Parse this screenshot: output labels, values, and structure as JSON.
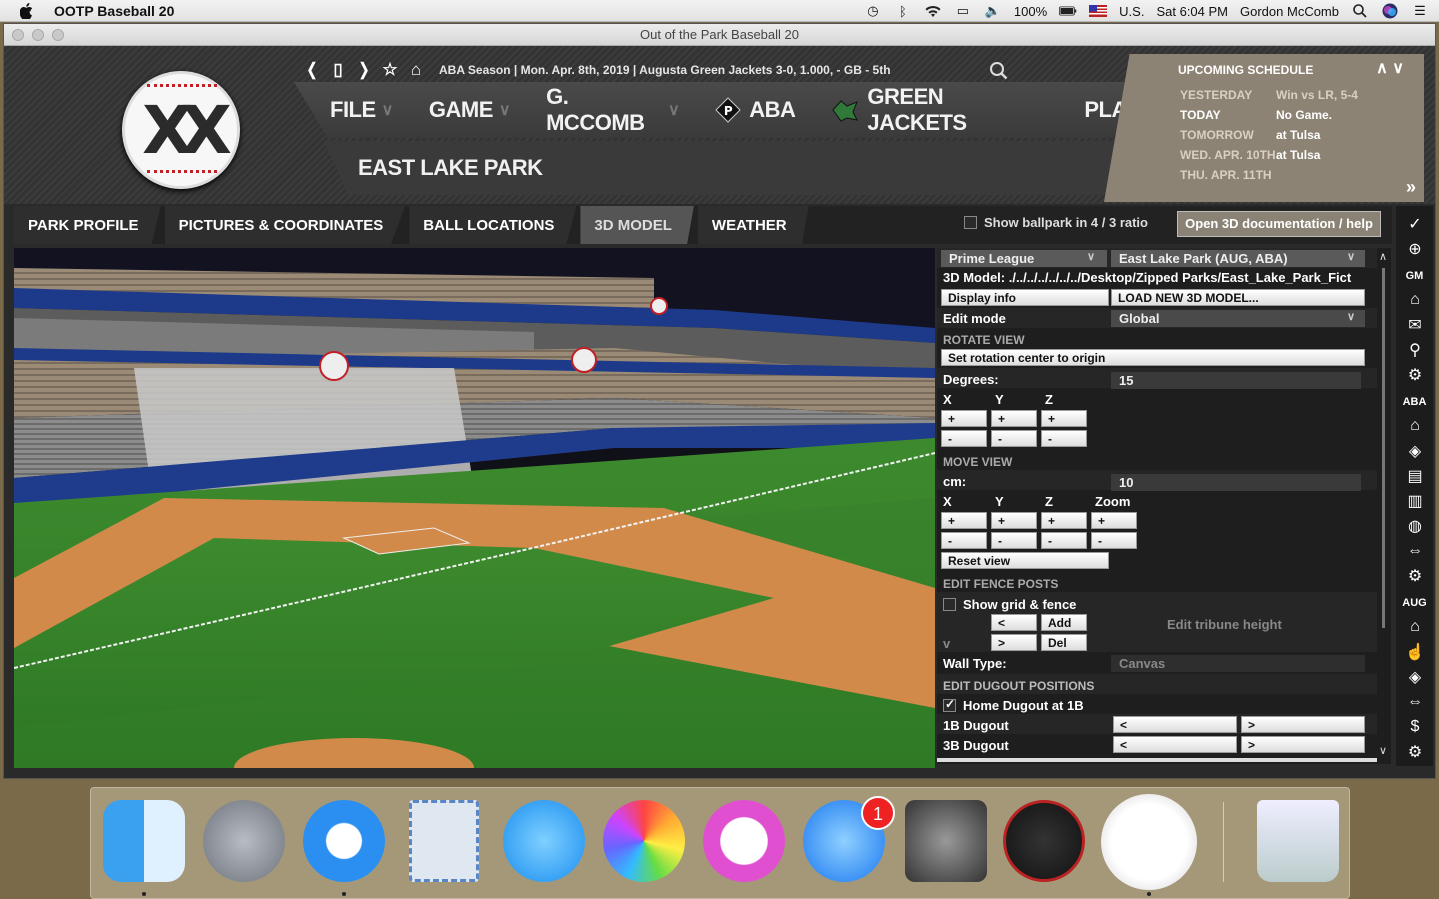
{
  "menubar": {
    "app_name": "OOTP Baseball 20",
    "battery": "100%",
    "input_source": "U.S.",
    "clock": "Sat 6:04 PM",
    "user": "Gordon McComb"
  },
  "window": {
    "title": "Out of the Park Baseball 20"
  },
  "nav": {
    "context": "ABA Season  |  Mon. Apr. 8th, 2019  |  Augusta Green Jackets   3-0, 1.000, - GB - 5th"
  },
  "main_menu": [
    {
      "label": "FILE"
    },
    {
      "label": "GAME"
    },
    {
      "label": "G. MCCOMB"
    },
    {
      "label": "ABA"
    },
    {
      "label": "GREEN JACKETS"
    },
    {
      "label": "PLAY"
    }
  ],
  "page": {
    "title": "EAST LAKE PARK"
  },
  "schedule": {
    "header": "UPCOMING SCHEDULE",
    "rows": [
      {
        "day": "YESTERDAY",
        "value": "Win vs LR, 5-4"
      },
      {
        "day": "TODAY",
        "value": "No Game."
      },
      {
        "day": "TOMORROW",
        "value": "at Tulsa"
      },
      {
        "day": "WED. APR. 10TH",
        "value": "at Tulsa"
      },
      {
        "day": "THU. APR. 11TH",
        "value": ""
      }
    ]
  },
  "tabs": [
    {
      "label": "PARK PROFILE"
    },
    {
      "label": "PICTURES & COORDINATES"
    },
    {
      "label": "BALL LOCATIONS"
    },
    {
      "label": "3D MODEL"
    },
    {
      "label": "WEATHER"
    }
  ],
  "toolbar": {
    "ratio_label": "Show ballpark in 4 / 3 ratio",
    "doc_button": "Open 3D documentation / help"
  },
  "panel": {
    "league": "Prime League",
    "park": "East Lake Park (AUG, ABA)",
    "model_path": "3D Model: ./../../../../../../Desktop/Zipped Parks/East_Lake_Park_Fict",
    "display_info": "Display info",
    "load_model": "LOAD NEW 3D MODEL...",
    "edit_mode_label": "Edit mode",
    "edit_mode_value": "Global",
    "rotate_header": "ROTATE VIEW",
    "set_rotation": "Set rotation center to origin",
    "degrees_label": "Degrees:",
    "degrees_value": "15",
    "x": "X",
    "y": "Y",
    "z": "Z",
    "zoom": "Zoom",
    "plus": "+",
    "minus": "-",
    "move_header": "MOVE VIEW",
    "cm_label": "cm:",
    "cm_value": "10",
    "reset_view": "Reset view",
    "fence_header": "EDIT FENCE POSTS",
    "show_grid": "Show grid & fence",
    "prev": "<",
    "next": ">",
    "add": "Add",
    "del": "Del",
    "v_label": "v",
    "tribune": "Edit tribune height",
    "wall_type_label": "Wall Type:",
    "wall_type_value": "Canvas",
    "dugout_header": "EDIT DUGOUT POSITIONS",
    "home_dugout": "Home Dugout at 1B",
    "dugout_1b": "1B Dugout",
    "dugout_3b": "3B Dugout"
  },
  "sidebar": {
    "gm": "GM",
    "aba": "ABA",
    "aug": "AUG"
  },
  "dock": {
    "badge": "1"
  },
  "colors": {
    "accent": "#8a8375",
    "panel_bg": "#1e1e1e",
    "header_bg": "#3a3a3a"
  }
}
